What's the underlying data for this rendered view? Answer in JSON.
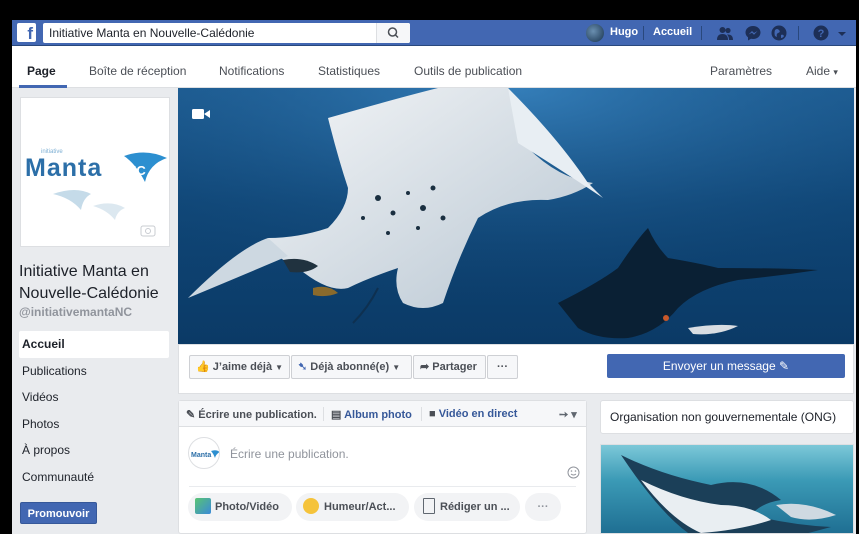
{
  "topbar": {
    "search_value": "Initiative Manta en Nouvelle-Calédonie",
    "user_name": "Hugo",
    "home_label": "Accueil",
    "icons": [
      "facebook-logo",
      "search-icon",
      "friends-icon",
      "messenger-icon",
      "globe-icon",
      "help-icon",
      "caret-down-icon"
    ]
  },
  "nav": {
    "tabs": [
      "Page",
      "Boîte de réception",
      "Notifications",
      "Statistiques",
      "Outils de publication"
    ],
    "settings_label": "Paramètres",
    "help_label": "Aide",
    "help_caret": "▾"
  },
  "page": {
    "logo_text": "Manta",
    "logo_badge": "NC",
    "logo_small": "initiative",
    "name": "Initiative Manta en Nouvelle-Calédonie",
    "handle": "@initiativemantaNC"
  },
  "left_nav": [
    "Accueil",
    "Publications",
    "Vidéos",
    "Photos",
    "À propos",
    "Communauté"
  ],
  "promote_label": "Promouvoir",
  "actions": {
    "like": "J’aime déjà",
    "follow": "Déjà abonné(e)",
    "share": "Partager",
    "more": "···",
    "message": "Envoyer un message"
  },
  "composer": {
    "tab_write": "Écrire une publication.",
    "tab_album": "Album photo",
    "tab_live": "Vidéo en direct",
    "placeholder": "Écrire une publication.",
    "avatar_text": "Manta",
    "btn_photo": "Photo/Vidéo",
    "btn_mood": "Humeur/Act...",
    "btn_note": "Rédiger un ...",
    "btn_more": "···"
  },
  "sidebar": {
    "category": "Organisation non gouvernementale (ONG)"
  },
  "colors": {
    "brand_blue": "#4267b2",
    "background": "#e9ebee"
  }
}
